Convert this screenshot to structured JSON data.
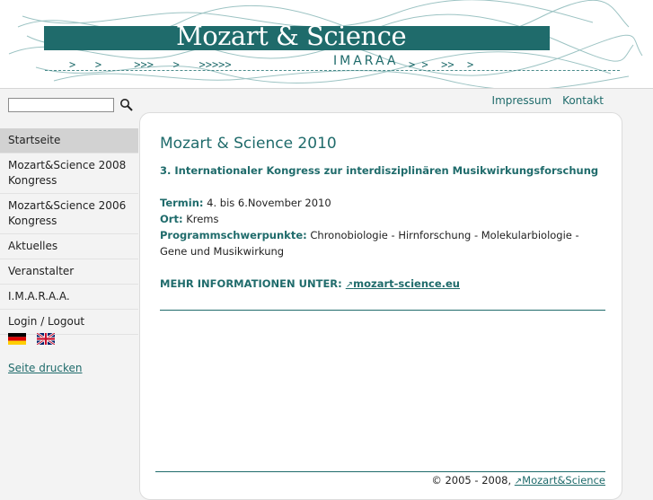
{
  "header": {
    "logo": "Mozart & Science",
    "sublogo": "IMARAA",
    "accent": "#1f6b6b"
  },
  "search": {
    "placeholder": "",
    "value": "",
    "icon": "search-icon"
  },
  "toplinks": [
    "Impressum",
    "Kontakt"
  ],
  "sidebar": {
    "items": [
      {
        "label": "Startseite",
        "active": true
      },
      {
        "label": "Mozart&Science 2008 Kongress"
      },
      {
        "label": "Mozart&Science 2006 Kongress"
      },
      {
        "label": "Aktuelles"
      },
      {
        "label": "Veranstalter"
      },
      {
        "label": "I.M.A.R.A.A."
      },
      {
        "label": "Login / Logout"
      }
    ],
    "flags": [
      "german-flag-icon",
      "uk-flag-icon"
    ],
    "print_label": "Seite drucken"
  },
  "content": {
    "title": "Mozart & Science 2010",
    "subtitle": "3. Internationaler Kongress zur interdisziplinären Musikwirkungsforschung",
    "termin_label": "Termin:",
    "termin_value": "4. bis 6.November 2010",
    "ort_label": "Ort:",
    "ort_value": "Krems",
    "schwerpunkte_label": "Programmschwerpunkte:",
    "schwerpunkte_value": "Chronobiologie - Hirnforschung - Molekularbiologie - Gene und Musikwirkung",
    "more_label": "MEHR INFORMATIONEN UNTER:",
    "more_link": "mozart-science.eu"
  },
  "footer": {
    "copyright": "© 2005 - 2008,",
    "link": "Mozart&Science"
  }
}
